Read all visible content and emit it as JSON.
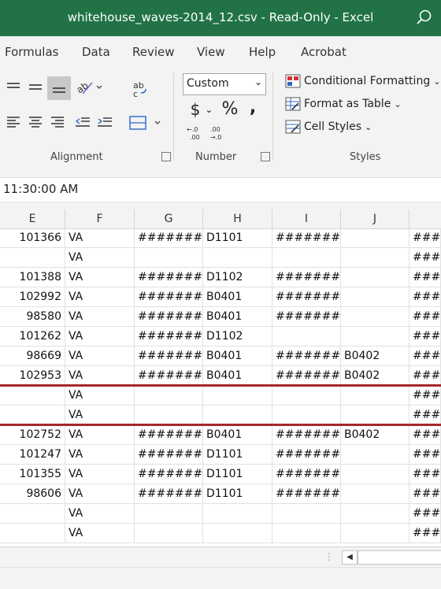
{
  "window": {
    "title": "whitehouse_waves-2014_12.csv  -  Read-Only  -  Excel"
  },
  "menu": [
    "Formulas",
    "Data",
    "Review",
    "View",
    "Help",
    "Acrobat"
  ],
  "ribbon": {
    "alignment_label": "Alignment",
    "number_label": "Number",
    "styles_label": "Styles",
    "number_format": "Custom",
    "styles": [
      "Conditional Formatting",
      "Format as Table",
      "Cell Styles"
    ],
    "wrap_glyph": "ab",
    "wrap_glyph2": "c",
    "dollar": "$",
    "percent": "%",
    "comma": ",",
    "inc_decimal": ".0\n.00",
    "dec_decimal": ".00\n.0"
  },
  "formula_bar": {
    "value": "11:30:00 AM"
  },
  "columns": [
    "E",
    "F",
    "G",
    "H",
    "I",
    "J",
    ""
  ],
  "rows": [
    [
      "101366",
      "VA",
      "########",
      "D1101",
      "########",
      "",
      "####"
    ],
    [
      "",
      "VA",
      "",
      "",
      "",
      "",
      "####"
    ],
    [
      "101388",
      "VA",
      "########",
      "D1102",
      "########",
      "",
      "####"
    ],
    [
      "102992",
      "VA",
      "########",
      "B0401",
      "########",
      "",
      "####"
    ],
    [
      "98580",
      "VA",
      "########",
      "B0401",
      "########",
      "",
      "####"
    ],
    [
      "101262",
      "VA",
      "########",
      "D1102",
      "",
      "",
      "####"
    ],
    [
      "98669",
      "VA",
      "########",
      "B0401",
      "########",
      "B0402",
      "####"
    ],
    [
      "102953",
      "VA",
      "########",
      "B0401",
      "########",
      "B0402",
      "####"
    ],
    [
      "",
      "VA",
      "",
      "",
      "",
      "",
      "####"
    ],
    [
      "",
      "VA",
      "",
      "",
      "",
      "",
      "####"
    ],
    [
      "102752",
      "VA",
      "########",
      "B0401",
      "########",
      "B0402",
      "####"
    ],
    [
      "101247",
      "VA",
      "########",
      "D1101",
      "########",
      "",
      "####"
    ],
    [
      "101355",
      "VA",
      "########",
      "D1101",
      "########",
      "",
      "####"
    ],
    [
      "98606",
      "VA",
      "########",
      "D1101",
      "########",
      "",
      "####"
    ],
    [
      "",
      "VA",
      "",
      "",
      "",
      "",
      "####"
    ],
    [
      "",
      "VA",
      "",
      "",
      "",
      "",
      "####"
    ]
  ]
}
